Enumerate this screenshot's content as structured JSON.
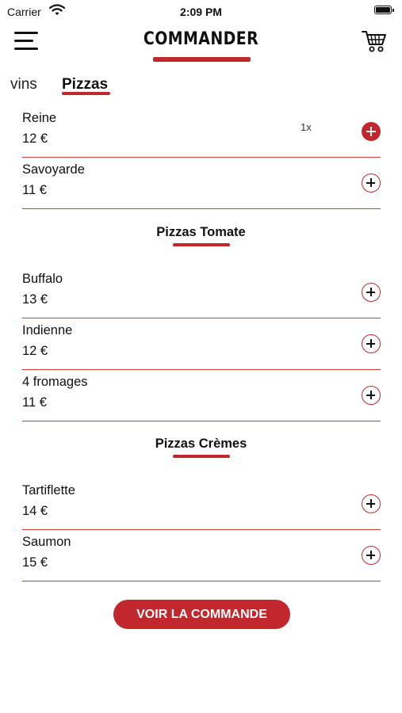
{
  "status_bar": {
    "carrier": "Carrier",
    "time": "2:09 PM"
  },
  "header": {
    "title": "COMMANDER",
    "menu_icon": "hamburger-menu-icon",
    "cart_icon": "shopping-cart-icon"
  },
  "tabs": [
    {
      "label": "vins",
      "selected": false
    },
    {
      "label": "Pizzas",
      "selected": true
    }
  ],
  "groups": [
    {
      "title": "",
      "items": [
        {
          "name": "Reine",
          "price": "12 €",
          "quantity": "1x"
        },
        {
          "name": "Savoyarde",
          "price": "11 €",
          "quantity": ""
        }
      ]
    },
    {
      "title": "Pizzas Tomate",
      "items": [
        {
          "name": "Buffalo",
          "price": "13 €",
          "quantity": ""
        },
        {
          "name": "Indienne",
          "price": "12 €",
          "quantity": ""
        },
        {
          "name": "4 fromages",
          "price": "11 €",
          "quantity": ""
        }
      ]
    },
    {
      "title": "Pizzas Crèmes",
      "items": [
        {
          "name": "Tartiflette",
          "price": "14 €",
          "quantity": ""
        },
        {
          "name": "Saumon",
          "price": "15 €",
          "quantity": ""
        }
      ]
    }
  ],
  "order_button": {
    "label": "VOIR LA COMMANDE"
  },
  "colors": {
    "accent": "#c1272d",
    "background": "#ffffff",
    "text": "#111111"
  }
}
